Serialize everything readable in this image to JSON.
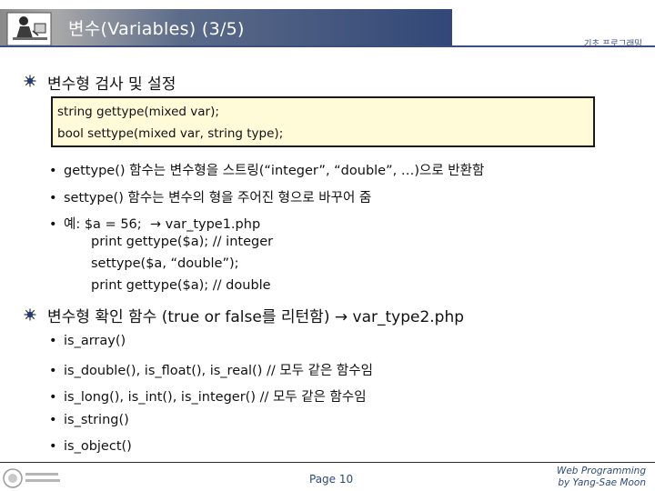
{
  "header": {
    "title": "변수(Variables) (3/5)",
    "subtitle": "기초 프로그래밍"
  },
  "section1": {
    "heading": "변수형 검사 및 설정",
    "code": [
      "string gettype(mixed var);",
      "bool settype(mixed var, string type);"
    ],
    "items": [
      "gettype() 함수는 변수형을 스트링(“integer”, “double”, …)으로 반환함",
      "settype() 함수는 변수의 형을 주어진 형으로 바꾸어 줌",
      "예: $a = 56;"
    ],
    "example_file": "var_type1.php",
    "example_lines": [
      "print gettype($a);  // integer",
      "settype($a, “double”);",
      "print gettype($a);  // double"
    ]
  },
  "section2": {
    "heading": "변수형 확인 함수 (true or false를 리턴함)",
    "file": "var_type2.php",
    "items": [
      "is_array()",
      "is_double(), is_float(), is_real()  // 모두 같은 함수임",
      "is_long(), is_int(), is_integer()  // 모두 같은 함수임",
      "is_string()",
      "is_object()"
    ]
  },
  "footer": {
    "page": "Page 10",
    "credit_line1": "Web Programming",
    "credit_line2": "by Yang-Sae Moon"
  },
  "colors": {
    "title_text": "#ffffff",
    "accent": "#3a4f7e",
    "code_bg": "#fffbd9",
    "footer_text": "#2f4a7a"
  }
}
